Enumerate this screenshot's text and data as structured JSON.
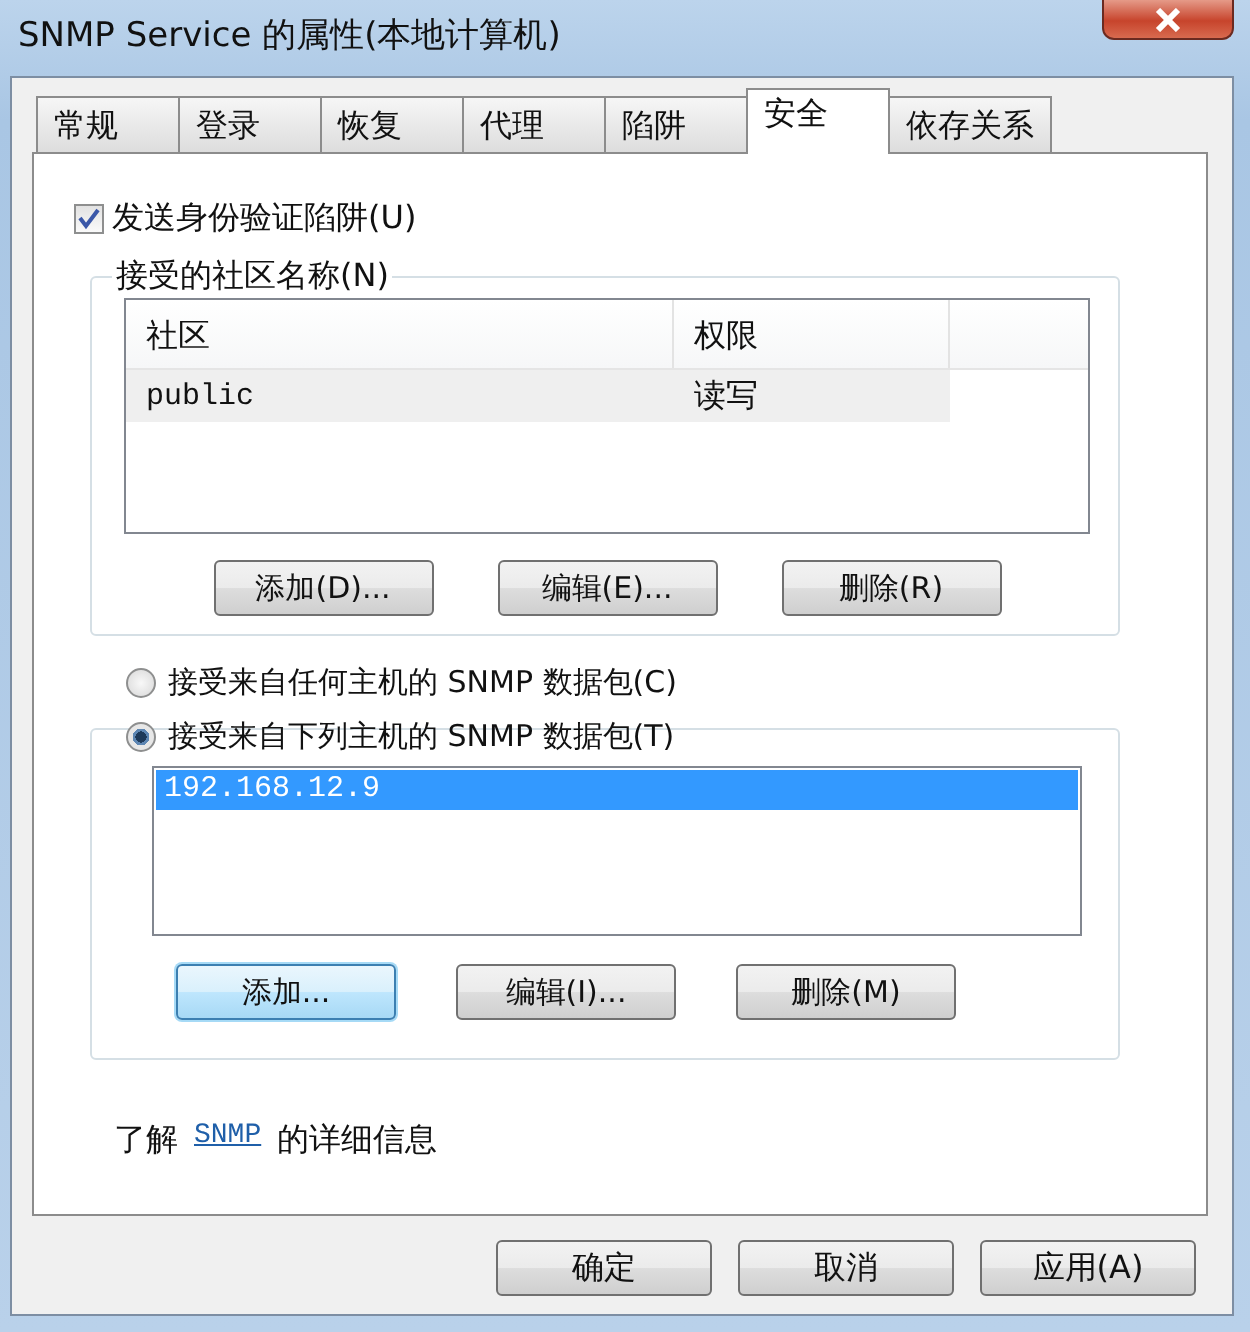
{
  "window": {
    "title": "SNMP Service 的属性(本地计算机)"
  },
  "tabs": [
    {
      "label": "常规",
      "selected": false
    },
    {
      "label": "登录",
      "selected": false
    },
    {
      "label": "恢复",
      "selected": false
    },
    {
      "label": "代理",
      "selected": false
    },
    {
      "label": "陷阱",
      "selected": false
    },
    {
      "label": "安全",
      "selected": true
    },
    {
      "label": "依存关系",
      "selected": false
    }
  ],
  "send_auth_trap": {
    "label": "发送身份验证陷阱(U)",
    "checked": true
  },
  "community_group": {
    "title": "接受的社区名称(N)",
    "columns": [
      "社区",
      "权限"
    ],
    "rows": [
      {
        "cells": [
          "public",
          "读写"
        ],
        "selected": true
      }
    ],
    "buttons": [
      {
        "label": "添加(D)...",
        "focused": false
      },
      {
        "label": "编辑(E)...",
        "focused": false
      },
      {
        "label": "删除(R)",
        "focused": false
      }
    ]
  },
  "host_options": [
    {
      "label": "接受来自任何主机的 SNMP 数据包(C)",
      "selected": false
    },
    {
      "label": "接受来自下列主机的 SNMP 数据包(T)",
      "selected": true
    }
  ],
  "host_list": {
    "items": [
      {
        "text": "192.168.12.9",
        "selected": true
      }
    ],
    "buttons": [
      {
        "label": "添加...",
        "focused": true
      },
      {
        "label": "编辑(I)...",
        "focused": false
      },
      {
        "label": "删除(M)",
        "focused": false
      }
    ]
  },
  "info": {
    "prefix": "了解",
    "link": "SNMP",
    "suffix": "的详细信息"
  },
  "footer_buttons": [
    {
      "label": "确定",
      "focused": false
    },
    {
      "label": "取消",
      "focused": false
    },
    {
      "label": "应用(A)",
      "focused": false
    }
  ]
}
